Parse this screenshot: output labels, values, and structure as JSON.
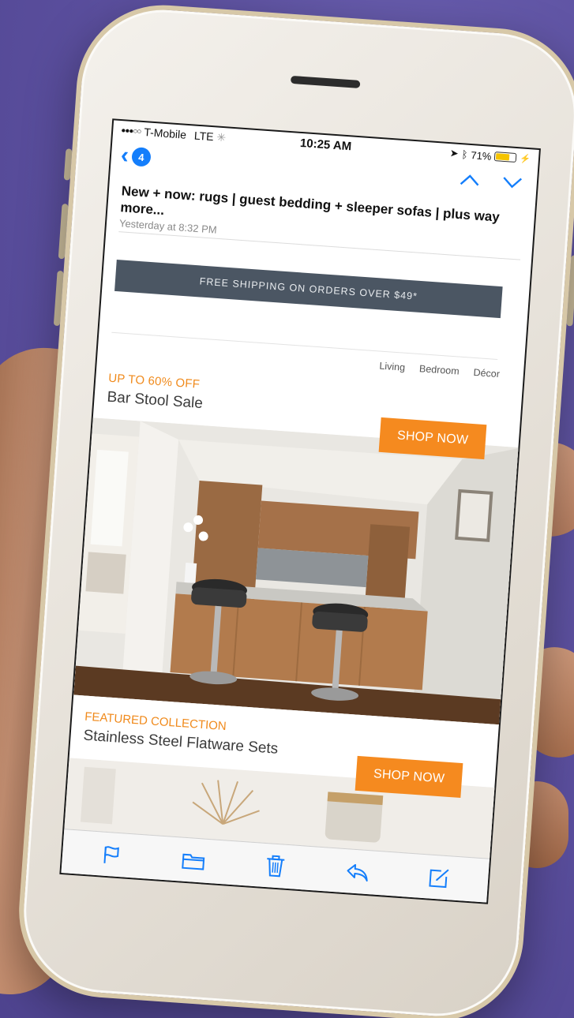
{
  "status_bar": {
    "carrier": "T-Mobile",
    "network": "LTE",
    "time": "10:25 AM",
    "battery_percent": "71%",
    "battery_level": 0.71
  },
  "mail": {
    "unread_count": "4",
    "subject": "New + now: rugs | guest bedding + sleeper sofas | plus way more...",
    "date": "Yesterday at 8:32 PM"
  },
  "email": {
    "shipping_banner": "FREE SHIPPING ON ORDERS OVER $49*",
    "categories": [
      "Living",
      "Bedroom",
      "Décor"
    ],
    "promo1": {
      "eyebrow": "UP TO 60% OFF",
      "title": "Bar Stool Sale",
      "button": "SHOP NOW"
    },
    "promo2": {
      "eyebrow": "FEATURED COLLECTION",
      "title": "Stainless Steel Flatware Sets",
      "button": "SHOP NOW"
    }
  },
  "icons": {
    "back": "chevron-left-icon",
    "prev": "chevron-up-icon",
    "next": "chevron-down-icon",
    "toolbar": [
      "flag-icon",
      "folder-icon",
      "trash-icon",
      "reply-icon",
      "compose-icon"
    ]
  },
  "colors": {
    "background": "#5b4f9e",
    "ios_blue": "#147efb",
    "accent_orange": "#f58a1f",
    "banner_gray": "#4b5663"
  }
}
